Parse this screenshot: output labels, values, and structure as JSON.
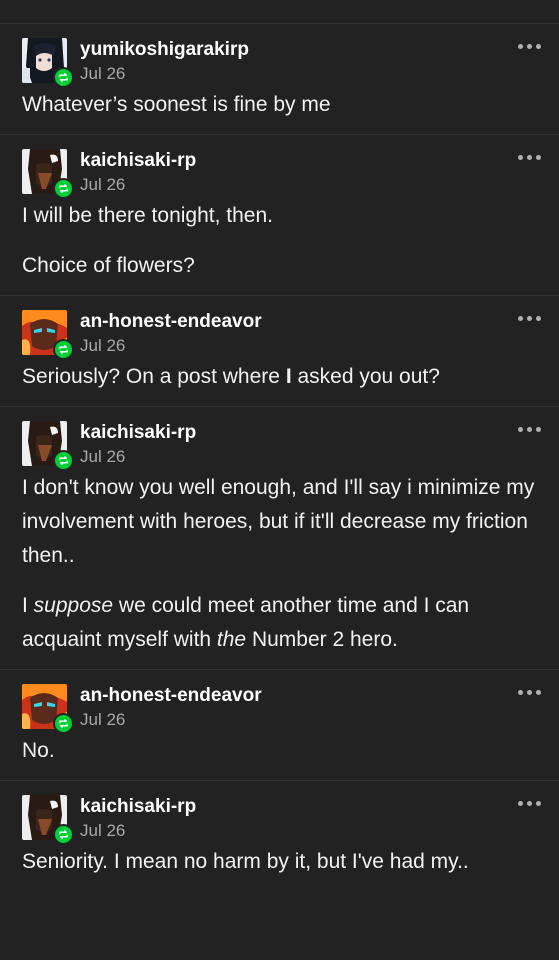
{
  "posts": [
    {
      "username": "yumikoshigarakirp",
      "date": "Jul 26",
      "paragraphs": [
        "Whatever’s soonest is fine by me"
      ]
    },
    {
      "username": "kaichisaki-rp",
      "date": "Jul 26",
      "paragraphs": [
        "I will be there tonight, then.",
        "Choice of flowers?"
      ]
    },
    {
      "username": "an-honest-endeavor",
      "date": "Jul 26",
      "p0_a": "Seriously? On a post where ",
      "p0_b": "I",
      "p0_c": " asked you out?"
    },
    {
      "username": "kaichisaki-rp",
      "date": "Jul 26",
      "p0": "I don't know you well enough, and I'll say i minimize my involvement with heroes, but if it'll decrease my friction then..",
      "p1_a": "I ",
      "p1_b": "suppose",
      "p1_c": " we could meet another time and I can acquaint myself with ",
      "p1_d": "the",
      "p1_e": " Number 2 hero."
    },
    {
      "username": "an-honest-endeavor",
      "date": "Jul 26",
      "paragraphs": [
        "No."
      ]
    },
    {
      "username": "kaichisaki-rp",
      "date": "Jul 26",
      "paragraphs": [
        "Seniority. I mean no harm by it, but I've had my.."
      ]
    }
  ],
  "colors": {
    "background": "#222222",
    "divider": "#333333",
    "reblog_badge": "#00cf35",
    "date_text": "#a8a8a8"
  },
  "icons": {
    "reblog": "reblog-icon",
    "more": "more-options-icon"
  }
}
